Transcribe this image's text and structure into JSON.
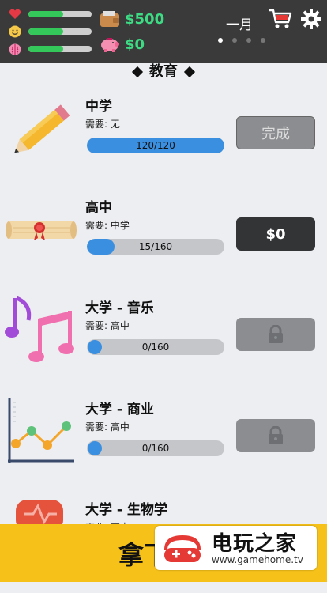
{
  "header": {
    "stats": [
      {
        "icon": "heart-icon",
        "fill": 0.55
      },
      {
        "icon": "smiley-icon",
        "fill": 0.55
      },
      {
        "icon": "brain-icon",
        "fill": 0.55
      }
    ],
    "cash": "$500",
    "savings": "$0",
    "month": "一月",
    "page_indicator": {
      "count": 4,
      "active": 1
    }
  },
  "section_title": "教育",
  "education": [
    {
      "name": "中学",
      "requirement": "需要: 无",
      "progress_text": "120/120",
      "progress": 1.0,
      "button": "完成",
      "button_state": "done"
    },
    {
      "name": "高中",
      "requirement": "需要: 中学",
      "progress_text": "15/160",
      "progress": 0.09,
      "button": "$0",
      "button_state": "buy"
    },
    {
      "name": "大学 - 音乐",
      "requirement": "需要: 高中",
      "progress_text": "0/160",
      "progress": 0.0,
      "button": "",
      "button_state": "locked"
    },
    {
      "name": "大学 - 商业",
      "requirement": "需要: 高中",
      "progress_text": "0/160",
      "progress": 0.0,
      "button": "",
      "button_state": "locked"
    },
    {
      "name": "大学 - 生物学",
      "requirement": "需要: 高中",
      "progress_text": "",
      "progress": 0.0,
      "button": "",
      "button_state": "locked"
    }
  ],
  "banner": {
    "text": "拿下"
  },
  "watermark": {
    "title": "电玩之家",
    "url": "www.gamehome.tv"
  },
  "colors": {
    "hud": "#3a3a3a",
    "stat_green": "#34c759",
    "money_green": "#3ddc84",
    "progress_blue": "#3b8fe0",
    "banner_yellow": "#f6c21a"
  }
}
